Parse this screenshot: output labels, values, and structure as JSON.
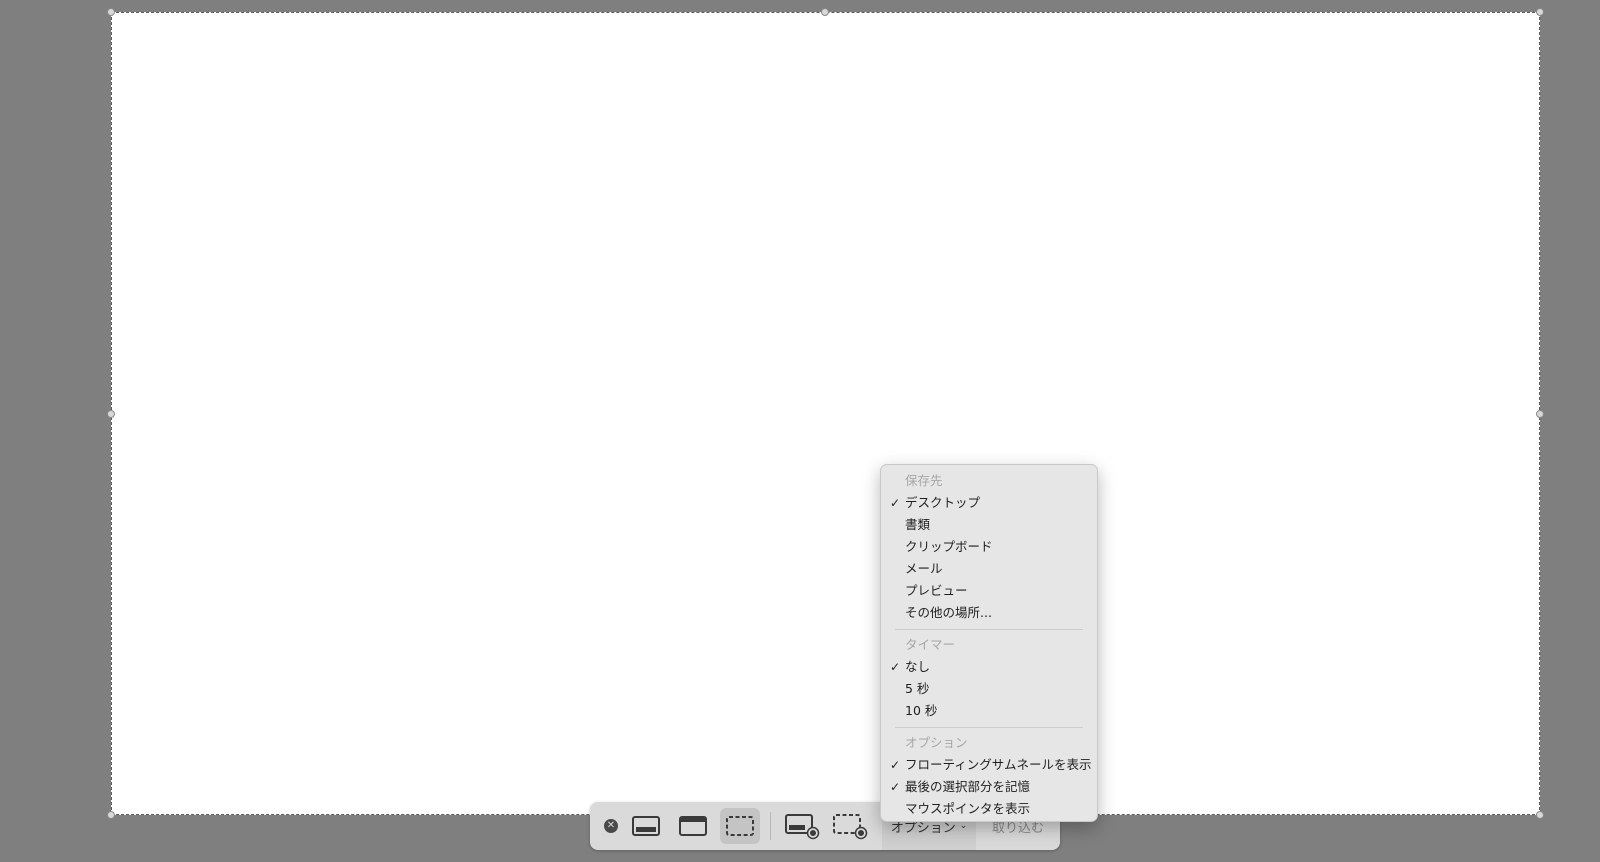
{
  "toolbar": {
    "close_icon": "close-icon",
    "buttons": [
      {
        "name": "capture-entire-screen",
        "icon": "entire-screen-icon",
        "active": false
      },
      {
        "name": "capture-window",
        "icon": "window-icon",
        "active": false
      },
      {
        "name": "capture-selection",
        "icon": "selection-icon",
        "active": true
      },
      {
        "name": "record-entire-screen",
        "icon": "record-screen-icon",
        "active": false
      },
      {
        "name": "record-selection",
        "icon": "record-selection-icon",
        "active": false
      }
    ],
    "options_label": "オプション",
    "capture_label": "取り込む"
  },
  "menu": {
    "save_header": "保存先",
    "save_items": [
      {
        "label": "デスクトップ",
        "checked": true
      },
      {
        "label": "書類",
        "checked": false
      },
      {
        "label": "クリップボード",
        "checked": false
      },
      {
        "label": "メール",
        "checked": false
      },
      {
        "label": "プレビュー",
        "checked": false
      },
      {
        "label": "その他の場所...",
        "checked": false
      }
    ],
    "timer_header": "タイマー",
    "timer_items": [
      {
        "label": "なし",
        "checked": true
      },
      {
        "label": "5 秒",
        "checked": false
      },
      {
        "label": "10 秒",
        "checked": false
      }
    ],
    "options_header": "オプション",
    "option_items": [
      {
        "label": "フローティングサムネールを表示",
        "checked": true
      },
      {
        "label": "最後の選択部分を記憶",
        "checked": true
      },
      {
        "label": "マウスポインタを表示",
        "checked": false
      }
    ],
    "check_glyph": "✓"
  },
  "colors": {
    "desktop_dim": "#7f7f7f",
    "selection_fill": "#ffffff",
    "menu_bg": "#e6e6e6",
    "toolbar_bg": "#dadada"
  }
}
